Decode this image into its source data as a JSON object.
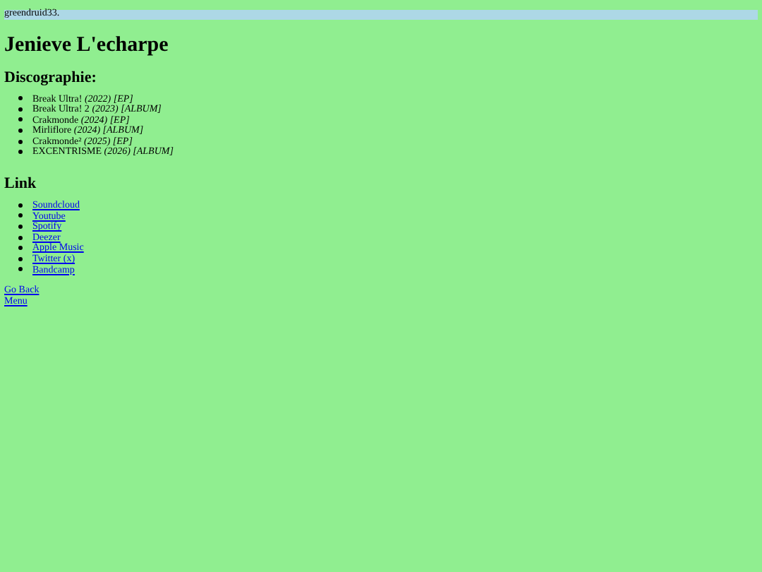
{
  "header": {
    "text": "greendruid33."
  },
  "title": "Jenieve L'echarpe",
  "discography": {
    "heading": "Discographie:",
    "items": [
      {
        "name": "Break Ultra!",
        "details": "(2022) [EP]"
      },
      {
        "name": "Break Ultra! 2",
        "details": "(2023) [ALBUM]"
      },
      {
        "name": "Crakmonde",
        "details": "(2024) [EP]"
      },
      {
        "name": "Mirliflore",
        "details": "(2024) [ALBUM]"
      },
      {
        "name": "Crakmonde²",
        "details": "(2025) [EP]"
      },
      {
        "name": "EXCENTRISME",
        "details": "(2026) [ALBUM]"
      }
    ]
  },
  "links": {
    "heading": "Link",
    "items": [
      "Soundcloud",
      "Youtube",
      "Spotify",
      "Deezer",
      "Apple Music",
      "Twitter (x)",
      "Bandcamp"
    ]
  },
  "nav": [
    "Go Back",
    "Menu"
  ]
}
